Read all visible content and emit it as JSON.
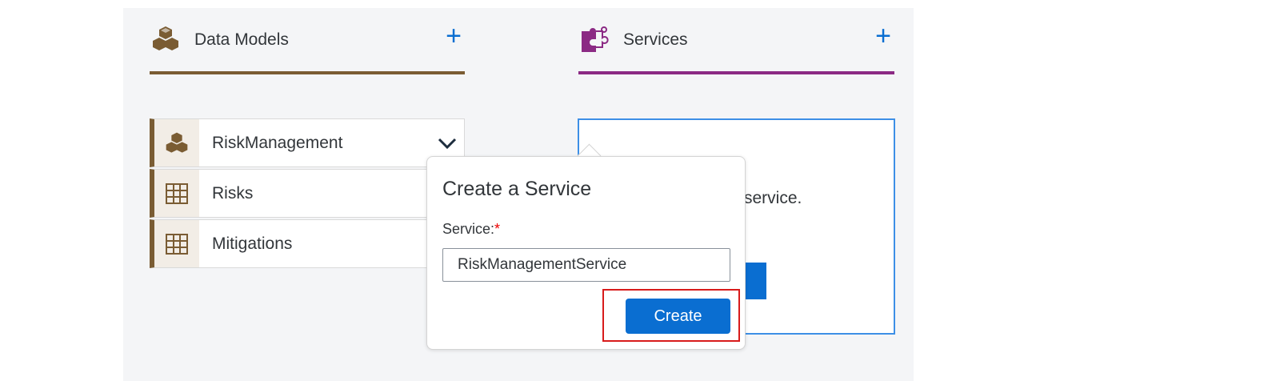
{
  "colors": {
    "data_models_accent": "#7a5c33",
    "services_accent": "#8b2a84",
    "primary_blue": "#0a6ed1",
    "highlight_red": "#d81b1b"
  },
  "data_models": {
    "title": "Data Models",
    "icon": "cube-cluster-icon",
    "add_label": "+",
    "entities": [
      {
        "label": "RiskManagement",
        "icon": "cube-cluster-icon",
        "expandable": true
      },
      {
        "label": "Risks",
        "icon": "table-grid-icon"
      },
      {
        "label": "Mitigations",
        "icon": "table-grid-icon"
      }
    ]
  },
  "services": {
    "title": "Services",
    "icon": "puzzle-icon",
    "add_label": "+",
    "empty_text_visible": "service."
  },
  "popover": {
    "title": "Create a Service",
    "field_label": "Service:",
    "required_mark": "*",
    "field_value": "RiskManagementService",
    "create_label": "Create"
  }
}
